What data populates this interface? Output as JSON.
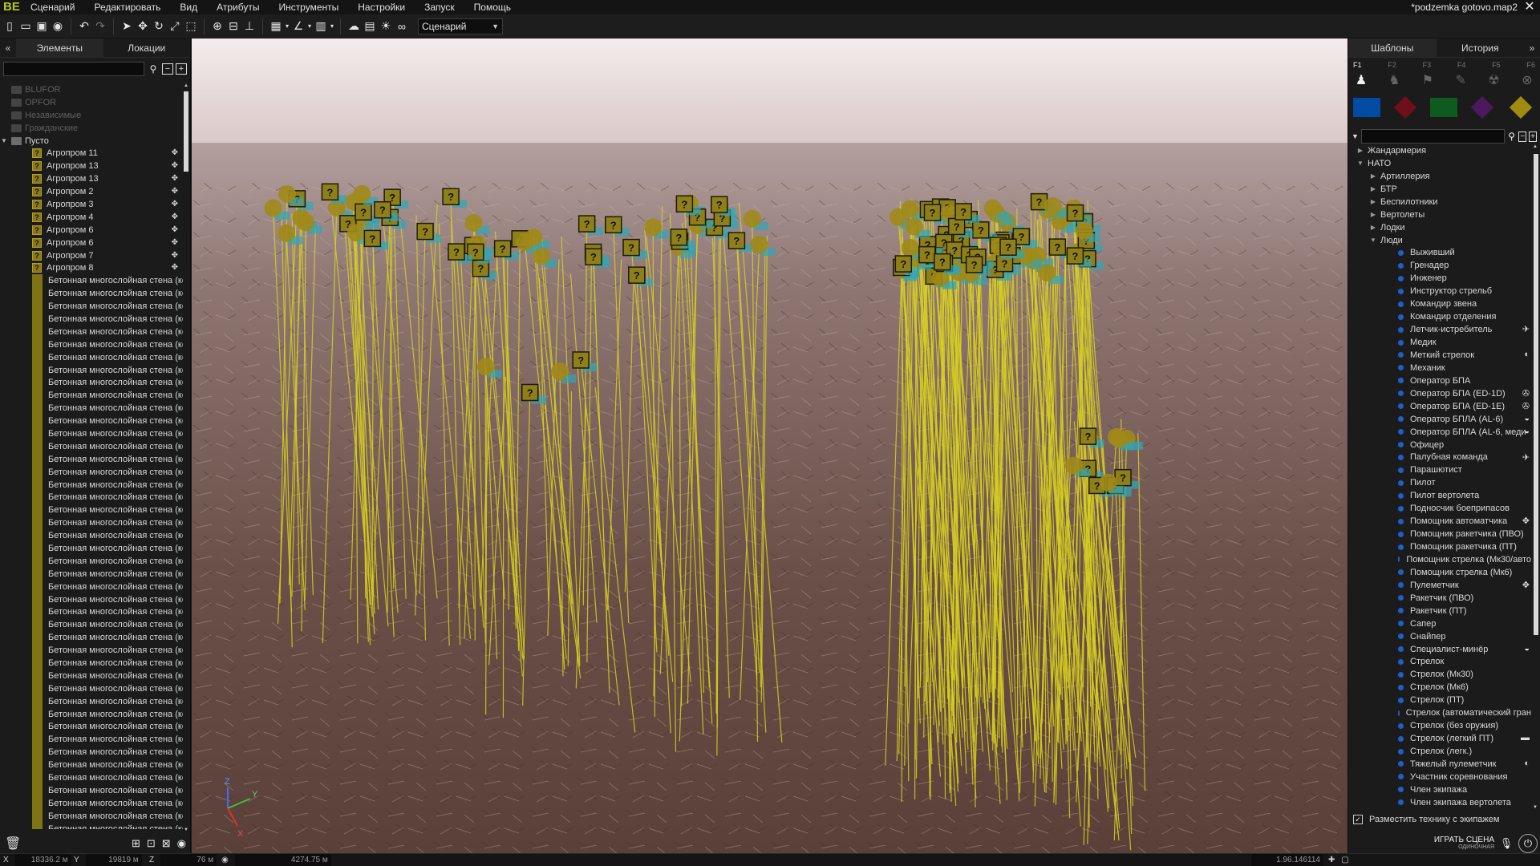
{
  "app": {
    "logo": "BE",
    "document_title": "*podzemka gotovo.map2"
  },
  "menu": [
    "Сценарий",
    "Редактировать",
    "Вид",
    "Атрибуты",
    "Инструменты",
    "Настройки",
    "Запуск",
    "Помощь"
  ],
  "toolbar": {
    "mode_select": "Сценарий"
  },
  "left_panel": {
    "tabs": [
      "Элементы",
      "Локации"
    ],
    "active_tab": 0,
    "sides": [
      "BLUFOR",
      "OPFOR",
      "Независимые",
      "Гражданские"
    ],
    "group": "Пусто",
    "entities": [
      "Агропром 11",
      "Агропром 13",
      "Агропром 13",
      "Агропром 2",
      "Агропром 3",
      "Агропром 4",
      "Агропром 6",
      "Агропром 6",
      "Агропром 7",
      "Агропром 8"
    ],
    "wall_label": "Бетонная многослойная стена (ко",
    "wall_count": 44
  },
  "right_panel": {
    "tabs": [
      "Шаблоны",
      "История"
    ],
    "active_tab": 0,
    "f_keys": [
      "F1",
      "F2",
      "F3",
      "F4",
      "F5",
      "F6"
    ],
    "unit_icons": [
      "soldier-icon",
      "group-icon",
      "module-icon",
      "marker-icon",
      "trigger-icon",
      "waypoint-icon"
    ],
    "side_colors": [
      "#004ba3",
      "#6e0f1a",
      "#0f5a1e",
      "#4b1a5e",
      "#a08a10"
    ],
    "factions": [
      {
        "label": "Жандармерия",
        "level": 0,
        "expanded": false
      },
      {
        "label": "НАТО",
        "level": 0,
        "expanded": true
      },
      {
        "label": "Артиллерия",
        "level": 1,
        "expanded": false
      },
      {
        "label": "БТР",
        "level": 1,
        "expanded": false
      },
      {
        "label": "Беспилотники",
        "level": 1,
        "expanded": false
      },
      {
        "label": "Вертолеты",
        "level": 1,
        "expanded": false
      },
      {
        "label": "Лодки",
        "level": 1,
        "expanded": false
      },
      {
        "label": "Люди",
        "level": 1,
        "expanded": true
      }
    ],
    "units": [
      {
        "label": "Выживший"
      },
      {
        "label": "Гренадер"
      },
      {
        "label": "Инженер"
      },
      {
        "label": "Инструктор стрельб"
      },
      {
        "label": "Командир звена"
      },
      {
        "label": "Командир отделения"
      },
      {
        "label": "Летчик-истребитель",
        "icon": "jet-icon"
      },
      {
        "label": "Медик"
      },
      {
        "label": "Меткий стрелок",
        "icon": "dlc-icon"
      },
      {
        "label": "Механик"
      },
      {
        "label": "Оператор БПА"
      },
      {
        "label": "Оператор БПА (ED-1D)",
        "icon": "drone-icon"
      },
      {
        "label": "Оператор БПА (ED-1E)",
        "icon": "drone-icon"
      },
      {
        "label": "Оператор БПЛА (AL-6)",
        "icon": "helmet-icon"
      },
      {
        "label": "Оператор БПЛА (AL-6, меди",
        "icon": "helmet-icon"
      },
      {
        "label": "Офицер"
      },
      {
        "label": "Палубная команда",
        "icon": "jet-icon"
      },
      {
        "label": "Парашютист"
      },
      {
        "label": "Пилот"
      },
      {
        "label": "Пилот вертолета"
      },
      {
        "label": "Подносчик боеприпасов"
      },
      {
        "label": "Помощник автоматчика",
        "icon": "apex-icon"
      },
      {
        "label": "Помощник ракетчика (ПВО)"
      },
      {
        "label": "Помощник ракетчика (ПТ)"
      },
      {
        "label": "Помощник стрелка (Мк30/авто"
      },
      {
        "label": "Помощник стрелка (Мк6)"
      },
      {
        "label": "Пулеметчик",
        "icon": "apex-icon"
      },
      {
        "label": "Ракетчик (ПВО)"
      },
      {
        "label": "Ракетчик (ПТ)"
      },
      {
        "label": "Сапер"
      },
      {
        "label": "Снайпер"
      },
      {
        "label": "Специалист-минёр",
        "icon": "helmet-icon"
      },
      {
        "label": "Стрелок"
      },
      {
        "label": "Стрелок (Мк30)"
      },
      {
        "label": "Стрелок (Мк6)"
      },
      {
        "label": "Стрелок (ПТ)"
      },
      {
        "label": "Стрелок (автоматический гран"
      },
      {
        "label": "Стрелок (без оружия)"
      },
      {
        "label": "Стрелок (легкий ПТ)",
        "icon": "tank-icon"
      },
      {
        "label": "Стрелок (легк.)"
      },
      {
        "label": "Тяжелый пулеметчик",
        "icon": "dlc-icon"
      },
      {
        "label": "Участник соревнования"
      },
      {
        "label": "Член экипажа"
      },
      {
        "label": "Член экипажа вертолета"
      }
    ],
    "crew_checkbox": "Разместить технику с экипажем",
    "crew_checked": true,
    "play_label": "ИГРАТЬ СЦЕНА",
    "play_sub": "ОДИНОЧНАЯ"
  },
  "statusbar": {
    "x_label": "X",
    "x_value": "18336.2 м",
    "y_label": "Y",
    "y_value": "19819 м",
    "z_label": "Z",
    "z_value": "76 м",
    "view_value": "4274.75 м",
    "zoom_value": "1.96.146114"
  }
}
